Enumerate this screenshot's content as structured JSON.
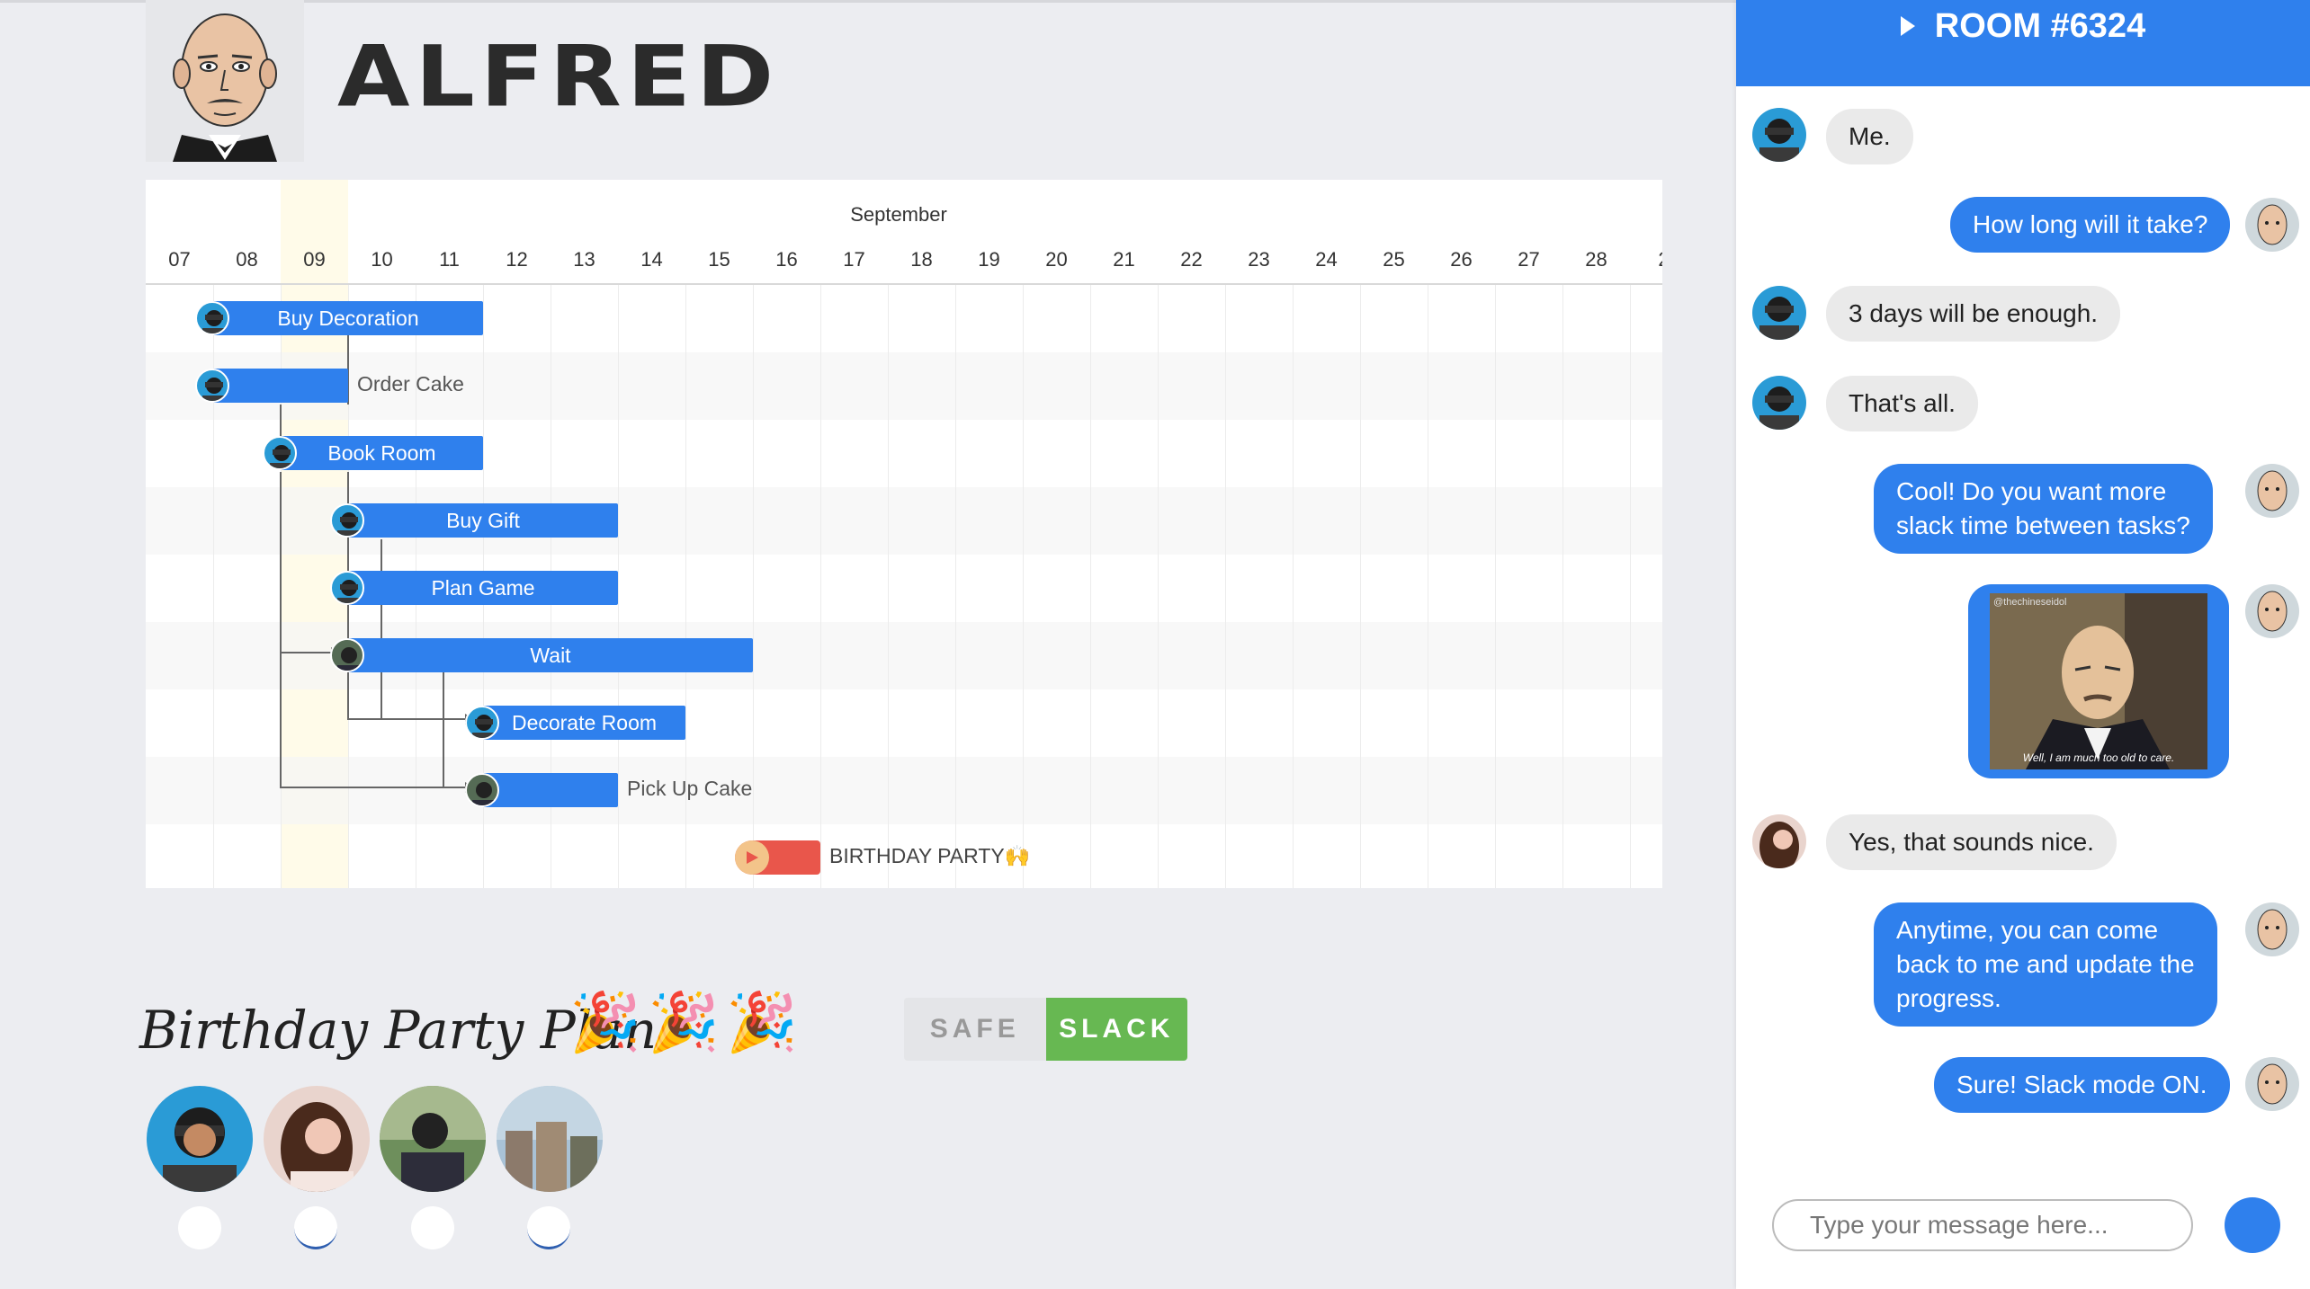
{
  "app": {
    "brand": "ALFRED"
  },
  "gantt": {
    "month": "September",
    "days": [
      "07",
      "08",
      "09",
      "10",
      "11",
      "12",
      "13",
      "14",
      "15",
      "16",
      "17",
      "18",
      "19",
      "20",
      "21",
      "22",
      "23",
      "24",
      "25",
      "26",
      "27",
      "28",
      "2"
    ],
    "tasks": {
      "buy_decoration": "Buy Decoration",
      "order_cake": "Order Cake",
      "book_room": "Book Room",
      "buy_gift": "Buy Gift",
      "plan_game": "Plan Game",
      "wait": "Wait",
      "decorate_room": "Decorate Room",
      "pick_up_cake": "Pick Up Cake"
    },
    "milestone": "BIRTHDAY PARTY🙌"
  },
  "plan": {
    "title": "Birthday Party Plan",
    "emoji": "🎉",
    "toggle": {
      "safe": "SAFE",
      "slack": "SLACK",
      "active": "slack"
    }
  },
  "colors": {
    "accent": "#2f80ed",
    "slack": "#67b852",
    "milestone": "#e9564b"
  },
  "chat": {
    "room": "ROOM #6324",
    "messages": {
      "m1": "Me.",
      "m2": "How long will it take?",
      "m3": "3 days will be enough.",
      "m4": "That's all.",
      "m5a": "Cool! Do you want more",
      "m5b": "slack time between tasks?",
      "m6caption": "Well, I am much too old to care.",
      "m6tag": "@thechineseidol",
      "m7": "Yes, that sounds nice.",
      "m8a": "Anytime, you can come",
      "m8b": "back to me and update the",
      "m8c": "progress.",
      "m9": "Sure! Slack mode ON."
    },
    "input_placeholder": "Type your message here..."
  }
}
